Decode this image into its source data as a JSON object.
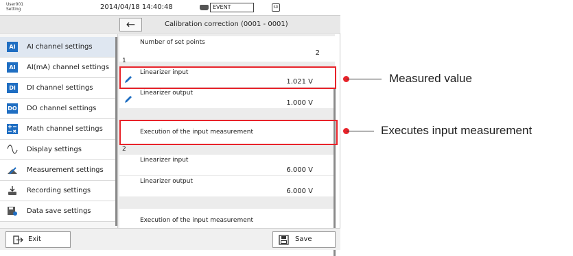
{
  "status": {
    "user": "User001",
    "mode": "Setting",
    "datetime": "2014/04/18 14:40:48",
    "event_label": "EVENT",
    "sd_label": "SD"
  },
  "header": {
    "back_icon": "left-arrow-icon",
    "title": "Calibration correction (0001 - 0001)"
  },
  "sidebar": {
    "items": [
      {
        "label": "AI channel settings",
        "icon": "AI",
        "active": true
      },
      {
        "label": "AI(mA) channel settings",
        "icon": "AI"
      },
      {
        "label": "DI channel settings",
        "icon": "DI"
      },
      {
        "label": "DO channel settings",
        "icon": "DO"
      },
      {
        "label": "Math channel settings",
        "icon": "math-icon"
      },
      {
        "label": "Display settings",
        "icon": "wave-icon"
      },
      {
        "label": "Measurement settings",
        "icon": "measurement-icon"
      },
      {
        "label": "Recording settings",
        "icon": "recording-icon"
      },
      {
        "label": "Data save settings",
        "icon": "save-settings-icon"
      }
    ]
  },
  "content": {
    "set_points_label": "Number of set points",
    "set_points_value": "2",
    "groups": [
      {
        "num": "1",
        "input_label": "Linearizer input",
        "input_value": "1.021 V",
        "output_label": "Linearizer output",
        "output_value": "1.000 V",
        "exec_label": "Execution of the input measurement"
      },
      {
        "num": "2",
        "input_label": "Linearizer input",
        "input_value": "6.000 V",
        "output_label": "Linearizer output",
        "output_value": "6.000 V",
        "exec_label": "Execution of the input measurement"
      }
    ]
  },
  "bottom": {
    "exit_label": "Exit",
    "save_label": "Save"
  },
  "callouts": {
    "measured": "Measured value",
    "executes": "Executes input measurement"
  },
  "colors": {
    "highlight": "#e8232a",
    "icon_blue": "#1f6ec2",
    "active_row": "#dfe7f1"
  }
}
